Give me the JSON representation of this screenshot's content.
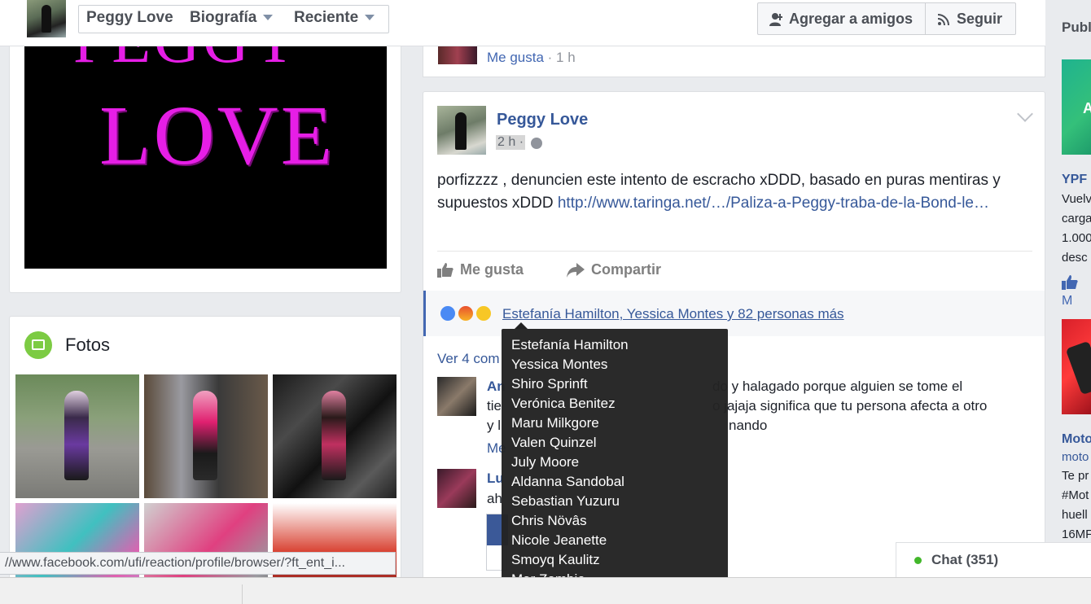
{
  "topbar": {
    "profile_name": "Peggy Love",
    "timeline_label": "Biografía",
    "recent_label": "Reciente",
    "add_friend_label": "Agregar a amigos",
    "follow_label": "Seguir"
  },
  "cover": {
    "top_text": "PEGGY",
    "main_text": "LOVE"
  },
  "photos": {
    "title": "Fotos"
  },
  "status_url": "//www.facebook.com/ufi/reaction/profile/browser/?ft_ent_i...",
  "prev_post": {
    "like_label": "Me gusta",
    "time": " · 1 h"
  },
  "post": {
    "author": "Peggy Love",
    "time": "2 h ·",
    "text": "porfizzzz , denuncien este intento de escracho xDDD, basado en puras mentiras y supuestos xDDD ",
    "link": "http://www.taringa.net/…/Paliza-a-Peggy-traba-de-la-Bond-le…",
    "like_action": "Me gusta",
    "share_action": "Compartir",
    "reactions_names": "Estefanía Hamilton, Yessica Montes y 82 personas más",
    "view_comments": "Ver 4 com",
    "comments": [
      {
        "name": "An",
        "lines": [
          "do y halagado porque alguien se tome el",
          "tie",
          "o jajaja significa que tu persona afecta a otro",
          "y l",
          "nando"
        ],
        "more": "Me"
      },
      {
        "name": "Lu",
        "text": "ah"
      }
    ]
  },
  "reactors": [
    "Estefanía Hamilton",
    "Yessica Montes",
    "Shiro Sprinft",
    "Verónica Benitez",
    "Maru Milkgore",
    "Valen Quinzel",
    "July Moore",
    "Aldanna Sandobal",
    "Sebastian Yuzuru",
    "Chris Növâs",
    "Nicole Jeanette",
    "Smoyq Kaulitz",
    "Mar Zombie"
  ],
  "ads": {
    "title": "Publ",
    "ad1": {
      "image_text": "A",
      "name": "YPF",
      "lines": [
        "Vuelv",
        "carga",
        "1.000",
        "desc"
      ],
      "like": "M"
    },
    "ad2": {
      "name": "Moto",
      "sub": "moto",
      "lines": [
        "Te pr",
        "#Mot",
        "huell",
        "16MF"
      ]
    }
  },
  "chat": {
    "label": "Chat (351)"
  },
  "colors": {
    "brand_blue": "#4267b2",
    "link_blue": "#365899",
    "cover_magenta": "#e61ee6",
    "tooltip_bg": "#232323",
    "chat_online": "#42b72a"
  }
}
